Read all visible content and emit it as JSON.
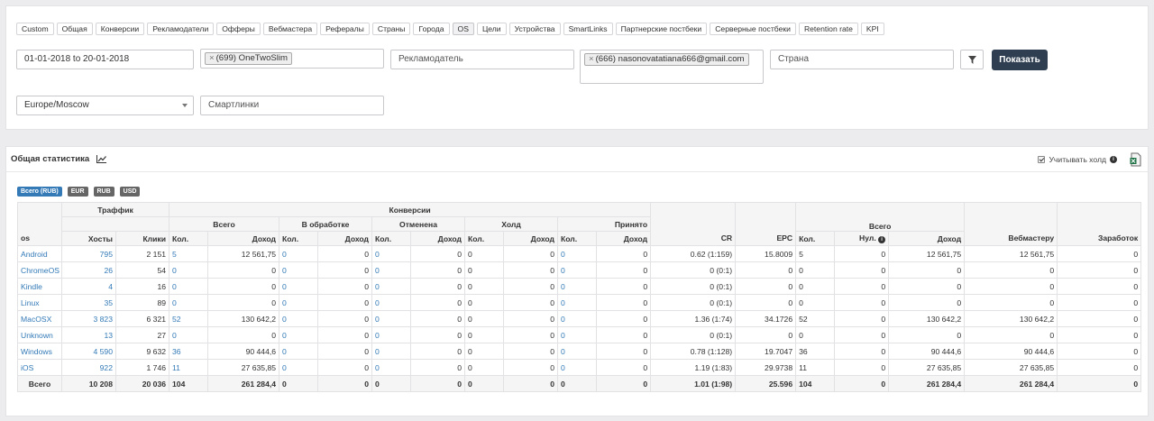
{
  "tabs": [
    "Custom",
    "Общая",
    "Конверсии",
    "Рекламодатели",
    "Офферы",
    "Вебмастера",
    "Рефералы",
    "Страны",
    "Города",
    "OS",
    "Цели",
    "Устройства",
    "SmartLinks",
    "Партнерские постбеки",
    "Серверные постбеки",
    "Retention rate",
    "KPI"
  ],
  "active_tab": "OS",
  "filters": {
    "date_range": "01-01-2018 to 20-01-2018",
    "offer_chip": "(699) OneTwoSlim",
    "advertiser_placeholder": "Рекламодатель",
    "webmaster_chip": "(666) nasonovatatiana666@gmail.com",
    "country_placeholder": "Страна",
    "show_button": "Показать",
    "timezone": "Europe/Moscow",
    "smartlinks_placeholder": "Смартлинки",
    "chip_remove": "×"
  },
  "stats": {
    "title": "Общая статистика",
    "hold_label": "Учитывать холд",
    "currencies": [
      "Всего (RUB)",
      "EUR",
      "RUB",
      "USD"
    ],
    "active_currency": "Всего (RUB)"
  },
  "table": {
    "groups": {
      "traffic": "Траффик",
      "conversions": "Конверсии",
      "total": "Всего"
    },
    "subgroups": {
      "all": "Всего",
      "processing": "В обработке",
      "cancelled": "Отменена",
      "hold": "Холд",
      "accepted": "Принято"
    },
    "cols": {
      "os": "os",
      "hosts": "Хосты",
      "clicks": "Клики",
      "qty": "Кол.",
      "income": "Доход",
      "cr": "CR",
      "epc": "EPC",
      "nul": "Нул.",
      "webmaster": "Вебмастеру",
      "earned": "Заработок"
    },
    "rows": [
      [
        "Android",
        "795",
        "2 151",
        "5",
        "12 561,75",
        "0",
        "0",
        "0",
        "0",
        "0",
        "0",
        "0",
        "0",
        "0.62 (1:159)",
        "15.8009",
        "5",
        "0",
        "12 561,75",
        "12 561,75",
        "0"
      ],
      [
        "ChromeOS",
        "26",
        "54",
        "0",
        "0",
        "0",
        "0",
        "0",
        "0",
        "0",
        "0",
        "0",
        "0",
        "0 (0:1)",
        "0",
        "0",
        "0",
        "0",
        "0",
        "0"
      ],
      [
        "Kindle",
        "4",
        "16",
        "0",
        "0",
        "0",
        "0",
        "0",
        "0",
        "0",
        "0",
        "0",
        "0",
        "0 (0:1)",
        "0",
        "0",
        "0",
        "0",
        "0",
        "0"
      ],
      [
        "Linux",
        "35",
        "89",
        "0",
        "0",
        "0",
        "0",
        "0",
        "0",
        "0",
        "0",
        "0",
        "0",
        "0 (0:1)",
        "0",
        "0",
        "0",
        "0",
        "0",
        "0"
      ],
      [
        "MacOSX",
        "3 823",
        "6 321",
        "52",
        "130 642,2",
        "0",
        "0",
        "0",
        "0",
        "0",
        "0",
        "0",
        "0",
        "1.36 (1:74)",
        "34.1726",
        "52",
        "0",
        "130 642,2",
        "130 642,2",
        "0"
      ],
      [
        "Unknown",
        "13",
        "27",
        "0",
        "0",
        "0",
        "0",
        "0",
        "0",
        "0",
        "0",
        "0",
        "0",
        "0 (0:1)",
        "0",
        "0",
        "0",
        "0",
        "0",
        "0"
      ],
      [
        "Windows",
        "4 590",
        "9 632",
        "36",
        "90 444,6",
        "0",
        "0",
        "0",
        "0",
        "0",
        "0",
        "0",
        "0",
        "0.78 (1:128)",
        "19.7047",
        "36",
        "0",
        "90 444,6",
        "90 444,6",
        "0"
      ],
      [
        "iOS",
        "922",
        "1 746",
        "11",
        "27 635,85",
        "0",
        "0",
        "0",
        "0",
        "0",
        "0",
        "0",
        "0",
        "1.19 (1:83)",
        "29.9738",
        "11",
        "0",
        "27 635,85",
        "27 635,85",
        "0"
      ]
    ],
    "total": [
      "Всего",
      "10 208",
      "20 036",
      "104",
      "261 284,4",
      "0",
      "0",
      "0",
      "0",
      "0",
      "0",
      "0",
      "0",
      "1.01 (1:98)",
      "25.596",
      "104",
      "0",
      "261 284,4",
      "261 284,4",
      "0"
    ]
  }
}
